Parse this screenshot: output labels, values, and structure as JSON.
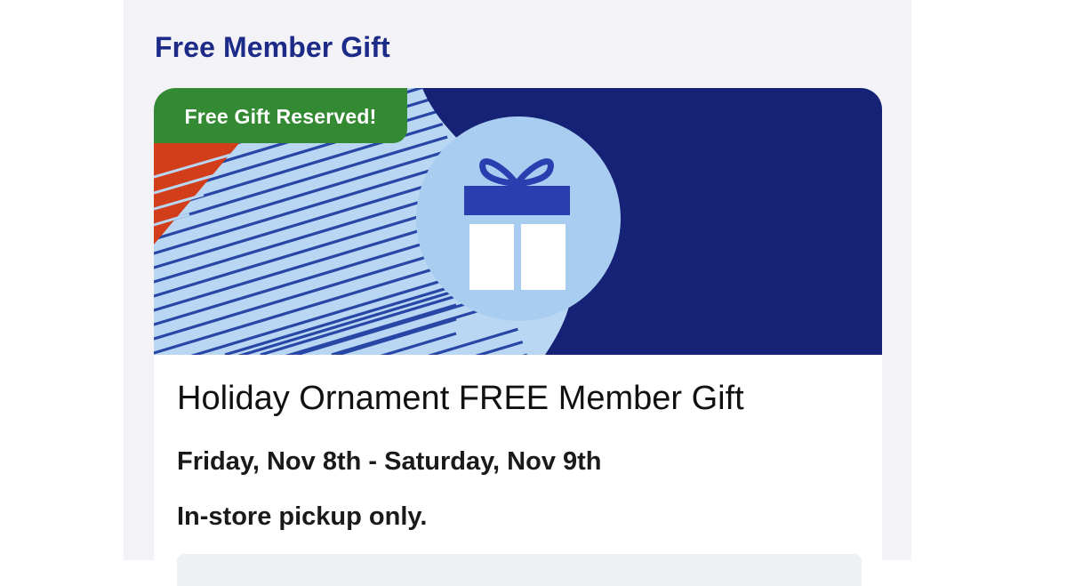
{
  "section": {
    "title": "Free Member Gift"
  },
  "gift_card": {
    "badge": "Free Gift Reserved!",
    "title": "Holiday Ornament FREE Member Gift",
    "dates": "Friday, Nov 8th - Saturday, Nov 9th",
    "pickup_note": "In-store pickup only.",
    "banner_icon": "gift-icon"
  },
  "colors": {
    "heading_blue": "#1c2a88",
    "banner_navy": "#152275",
    "banner_light_blue": "#a9cdf1",
    "stripe_blue": "#2746a6",
    "accent_red": "#d23d1a",
    "badge_green": "#348a33",
    "gift_blue": "#2a3eb0"
  }
}
